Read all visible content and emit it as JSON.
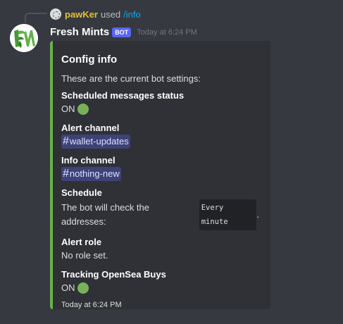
{
  "reply": {
    "username": "pawKer",
    "used_text": "used",
    "command": "/info"
  },
  "message": {
    "author": "Fresh Mints",
    "bot_tag": "BOT",
    "timestamp": "Today at 6:24 PM"
  },
  "embed": {
    "accent_color": "#67b347",
    "title": "Config info",
    "description": "These are the current bot settings:",
    "fields": [
      {
        "name": "Scheduled messages status",
        "value": "ON"
      },
      {
        "name": "Alert channel",
        "channel": "wallet-updates"
      },
      {
        "name": "Info channel",
        "channel": "nothing-new"
      },
      {
        "name": "Schedule",
        "value": "The bot will check the addresses:",
        "code": "Every minute",
        "suffix": "."
      },
      {
        "name": "Alert role",
        "value": "No role set."
      },
      {
        "name": "Tracking OpenSea Buys",
        "value": "ON"
      }
    ],
    "footer": "Today at 6:24 PM"
  },
  "icons": {
    "status": "green-circle-icon",
    "channel": "hash-icon",
    "reply_avatar": "avatar-icon",
    "author_avatar": "fresh-mints-logo"
  }
}
